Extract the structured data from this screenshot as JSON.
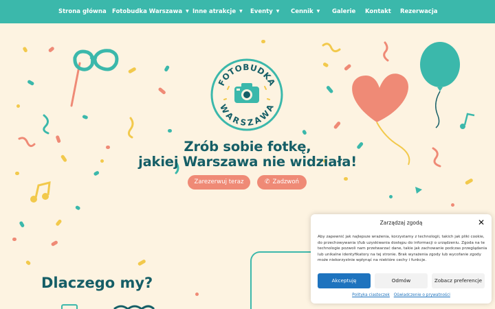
{
  "nav": {
    "items": [
      {
        "label": "Strona główna",
        "dropdown": false
      },
      {
        "label": "Fotobudka Warszawa",
        "dropdown": true
      },
      {
        "label": "Inne atrakcje",
        "dropdown": true
      },
      {
        "label": "Eventy",
        "dropdown": true
      },
      {
        "label": "Cennik",
        "dropdown": true
      },
      {
        "label": "Galerie",
        "dropdown": false
      },
      {
        "label": "Kontakt",
        "dropdown": false
      },
      {
        "label": "Rezerwacja",
        "dropdown": false
      }
    ],
    "caret": "▼"
  },
  "logo": {
    "text_top": "FOTOBUDKA",
    "text_bottom": "WARSZAWA"
  },
  "hero": {
    "title_line1": "Zrób sobie fotkę,",
    "title_line2": "jakiej Warszawa nie widziała!",
    "reserve_label": "Zarezerwuj teraz",
    "call_label": "Zadzwoń",
    "call_icon": "phone-icon"
  },
  "section": {
    "why_title": "Dlaczego my?"
  },
  "cookie": {
    "title": "Zarządzaj zgodą",
    "text": "Aby zapewnić jak najlepsze wrażenia, korzystamy z technologii, takich jak pliki cookie, do przechowywania i/lub uzyskiwania dostępu do informacji o urządzeniu. Zgoda na te technologie pozwoli nam przetwarzać dane, takie jak zachowanie podczas przeglądania lub unikalne identyfikatory na tej stronie. Brak wyrażenia zgody lub wycofanie zgody może niekorzystnie wpłynąć na niektóre cechy i funkcje.",
    "accept_label": "Akceptuję",
    "deny_label": "Odmów",
    "prefs_label": "Zobacz preferencje",
    "link_cookies": "Polityka ciasteczek",
    "link_privacy": "Oświadczenie o prywatności",
    "close_icon": "close-icon"
  },
  "colors": {
    "nav_bg": "#3bb8ab",
    "page_bg": "#fdf3e1",
    "heading": "#155e66",
    "button": "#ef8a76",
    "accept": "#1e73be"
  }
}
